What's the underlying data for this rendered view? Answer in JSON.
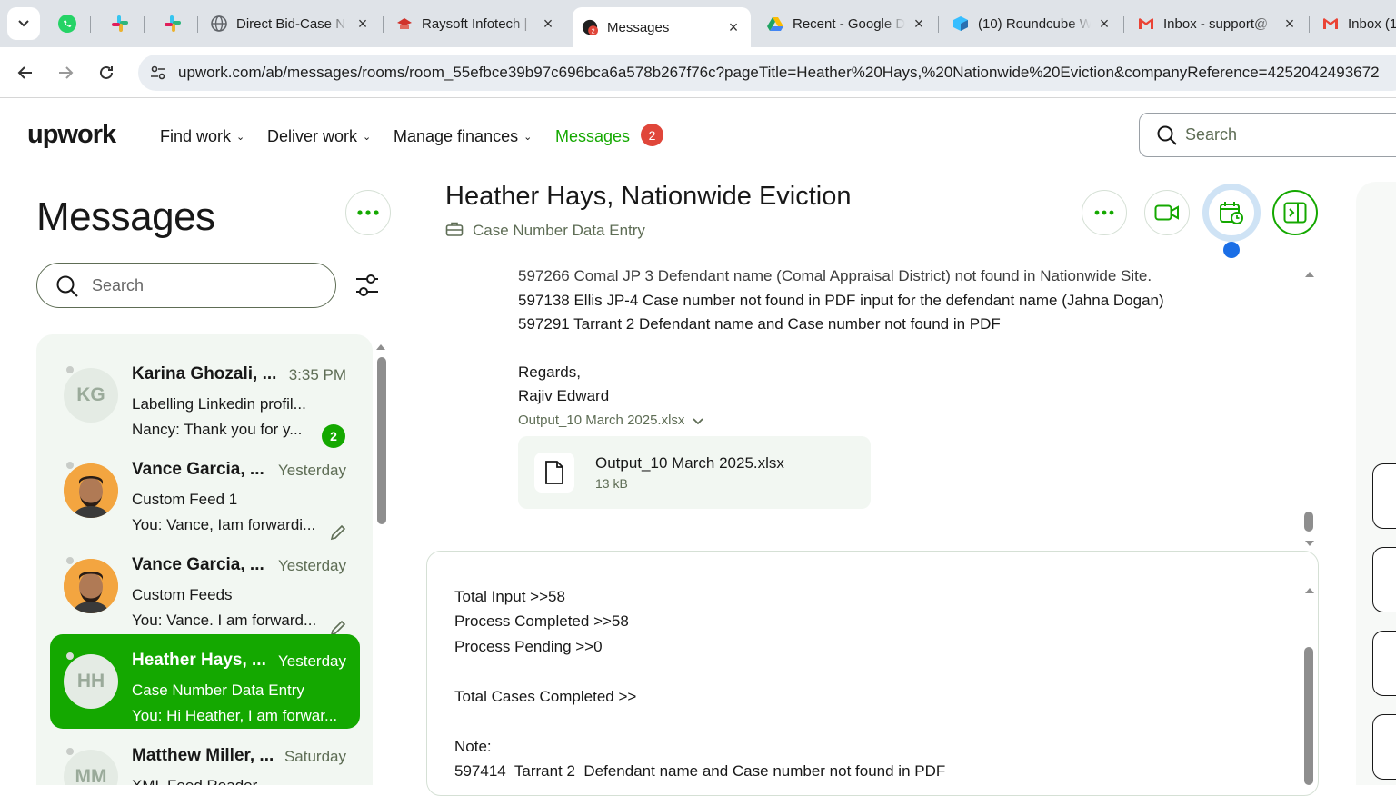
{
  "browser": {
    "tabs": [
      {
        "title": "Direct Bid-Case N",
        "icon": "globe-icon"
      },
      {
        "title": "Raysoft Infotech |",
        "icon": "raysoft-icon"
      },
      {
        "title": "Messages",
        "icon": "upwork-icon",
        "active": true
      },
      {
        "title": "Recent - Google D",
        "icon": "google-drive-icon"
      },
      {
        "title": "(10) Roundcube W",
        "icon": "roundcube-icon"
      },
      {
        "title": "Inbox - support@",
        "icon": "gmail-icon"
      },
      {
        "title": "Inbox (1",
        "icon": "gmail-icon"
      }
    ],
    "url": "upwork.com/ab/messages/rooms/room_55efbce39b97c696bca6a578b267f76c?pageTitle=Heather%20Hays,%20Nationwide%20Eviction&companyReference=4252042493672"
  },
  "header": {
    "logo": "upwork",
    "nav": [
      "Find work",
      "Deliver work",
      "Manage finances",
      "Messages"
    ],
    "messages_badge": "2",
    "search_placeholder": "Search"
  },
  "sidebar": {
    "title": "Messages",
    "search_placeholder": "Search",
    "conversations": [
      {
        "initials": "KG",
        "name": "Karina Ghozali, ...",
        "time": "3:35 PM",
        "subject": "Labelling Linkedin profil...",
        "preview": "Nancy: Thank you for y...",
        "unread": "2"
      },
      {
        "initials": "",
        "name": "Vance Garcia, ...",
        "time": "Yesterday",
        "subject": "Custom Feed 1",
        "preview": "You: Vance, Iam forwardi..."
      },
      {
        "initials": "",
        "name": "Vance Garcia, ...",
        "time": "Yesterday",
        "subject": "Custom Feeds",
        "preview": "You: Vance. I am forward..."
      },
      {
        "initials": "HH",
        "name": "Heather Hays, ...",
        "time": "Yesterday",
        "subject": "Case Number Data Entry",
        "preview": "You: Hi Heather, I am forwar..."
      },
      {
        "initials": "MM",
        "name": "Matthew Miller, ...",
        "time": "Saturday",
        "subject": "XML Feed Reader",
        "preview": ""
      }
    ]
  },
  "chat": {
    "title": "Heather Hays, Nationwide Eviction",
    "subtitle": "Case Number Data Entry",
    "thread_lines": [
      "597266 Comal JP 3 Defendant name (Comal Appraisal District) not found in Nationwide Site.",
      "597138 Ellis JP-4 Case number not found in PDF input for the defendant name (Jahna Dogan)",
      "597291 Tarrant 2 Defendant name and Case number not found in PDF",
      "Regards,",
      "Rajiv Edward"
    ],
    "attachment": {
      "link": "Output_10 March 2025.xlsx",
      "name": "Output_10 March 2025.xlsx",
      "size": "13 kB"
    },
    "composer_lines": [
      "Total Input >>58",
      "Process Completed >>58",
      "Process Pending >>0",
      "Total Cases Completed >>",
      "Note:",
      "597414  Tarrant 2  Defendant name and Case number not found in PDF"
    ]
  }
}
